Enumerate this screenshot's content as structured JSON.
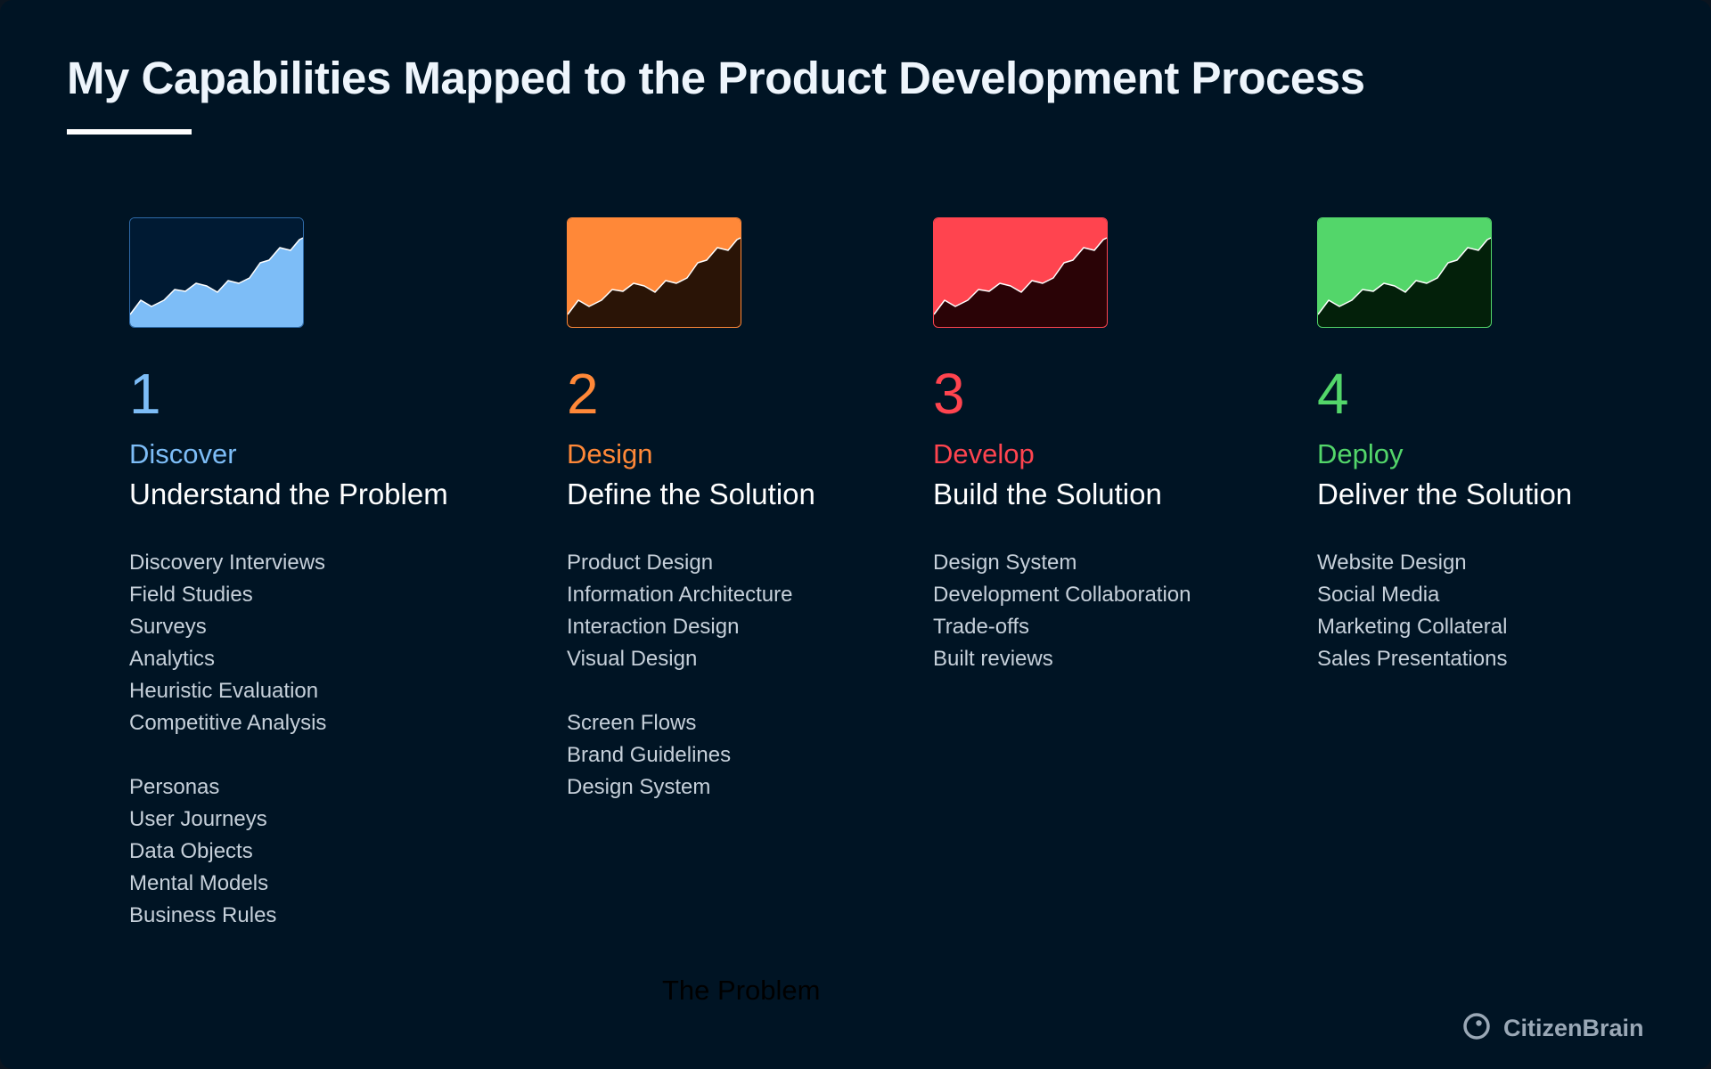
{
  "title": "My Capabilities Mapped to the Product Development Process",
  "steps": [
    {
      "number": "1",
      "name": "Discover",
      "tagline": "Understand the Problem",
      "accent": "#7dbdf7",
      "thumb_bg": "#001a33",
      "thumb_fill": "#7dbdf7",
      "thumb_border": "#2e6aa8",
      "groups": [
        [
          "Discovery Interviews",
          "Field Studies",
          "Surveys",
          "Analytics",
          "Heuristic Evaluation",
          "Competitive Analysis"
        ],
        [
          "Personas",
          "User Journeys",
          "Data Objects",
          "Mental Models",
          "Business Rules"
        ]
      ]
    },
    {
      "number": "2",
      "name": "Design",
      "tagline": "Define the Solution",
      "accent": "#ff8838",
      "thumb_bg": "#ff8838",
      "thumb_fill": "#2a1406",
      "thumb_border": "#ff8838",
      "groups": [
        [
          "Product Design",
          "Information Architecture",
          "Interaction Design",
          "Visual Design"
        ],
        [
          "Screen Flows",
          "Brand Guidelines",
          "Design System"
        ]
      ]
    },
    {
      "number": "3",
      "name": "Develop",
      "tagline": "Build the Solution",
      "accent": "#ff444f",
      "thumb_bg": "#ff444f",
      "thumb_fill": "#2a0306",
      "thumb_border": "#ff444f",
      "groups": [
        [
          "Design System",
          "Development Collaboration",
          "Trade-offs",
          "Built reviews"
        ]
      ]
    },
    {
      "number": "4",
      "name": "Deploy",
      "tagline": "Deliver the Solution",
      "accent": "#53d66a",
      "thumb_bg": "#53d66a",
      "thumb_fill": "#03200a",
      "thumb_border": "#53d66a",
      "groups": [
        [
          "Website Design",
          "Social Media",
          "Marketing Collateral",
          "Sales Presentations"
        ]
      ]
    }
  ],
  "footnote": "The Problem",
  "brand": {
    "name": "CitizenBrain",
    "icon": "target-logo-icon",
    "color": "#9aa8b6"
  }
}
